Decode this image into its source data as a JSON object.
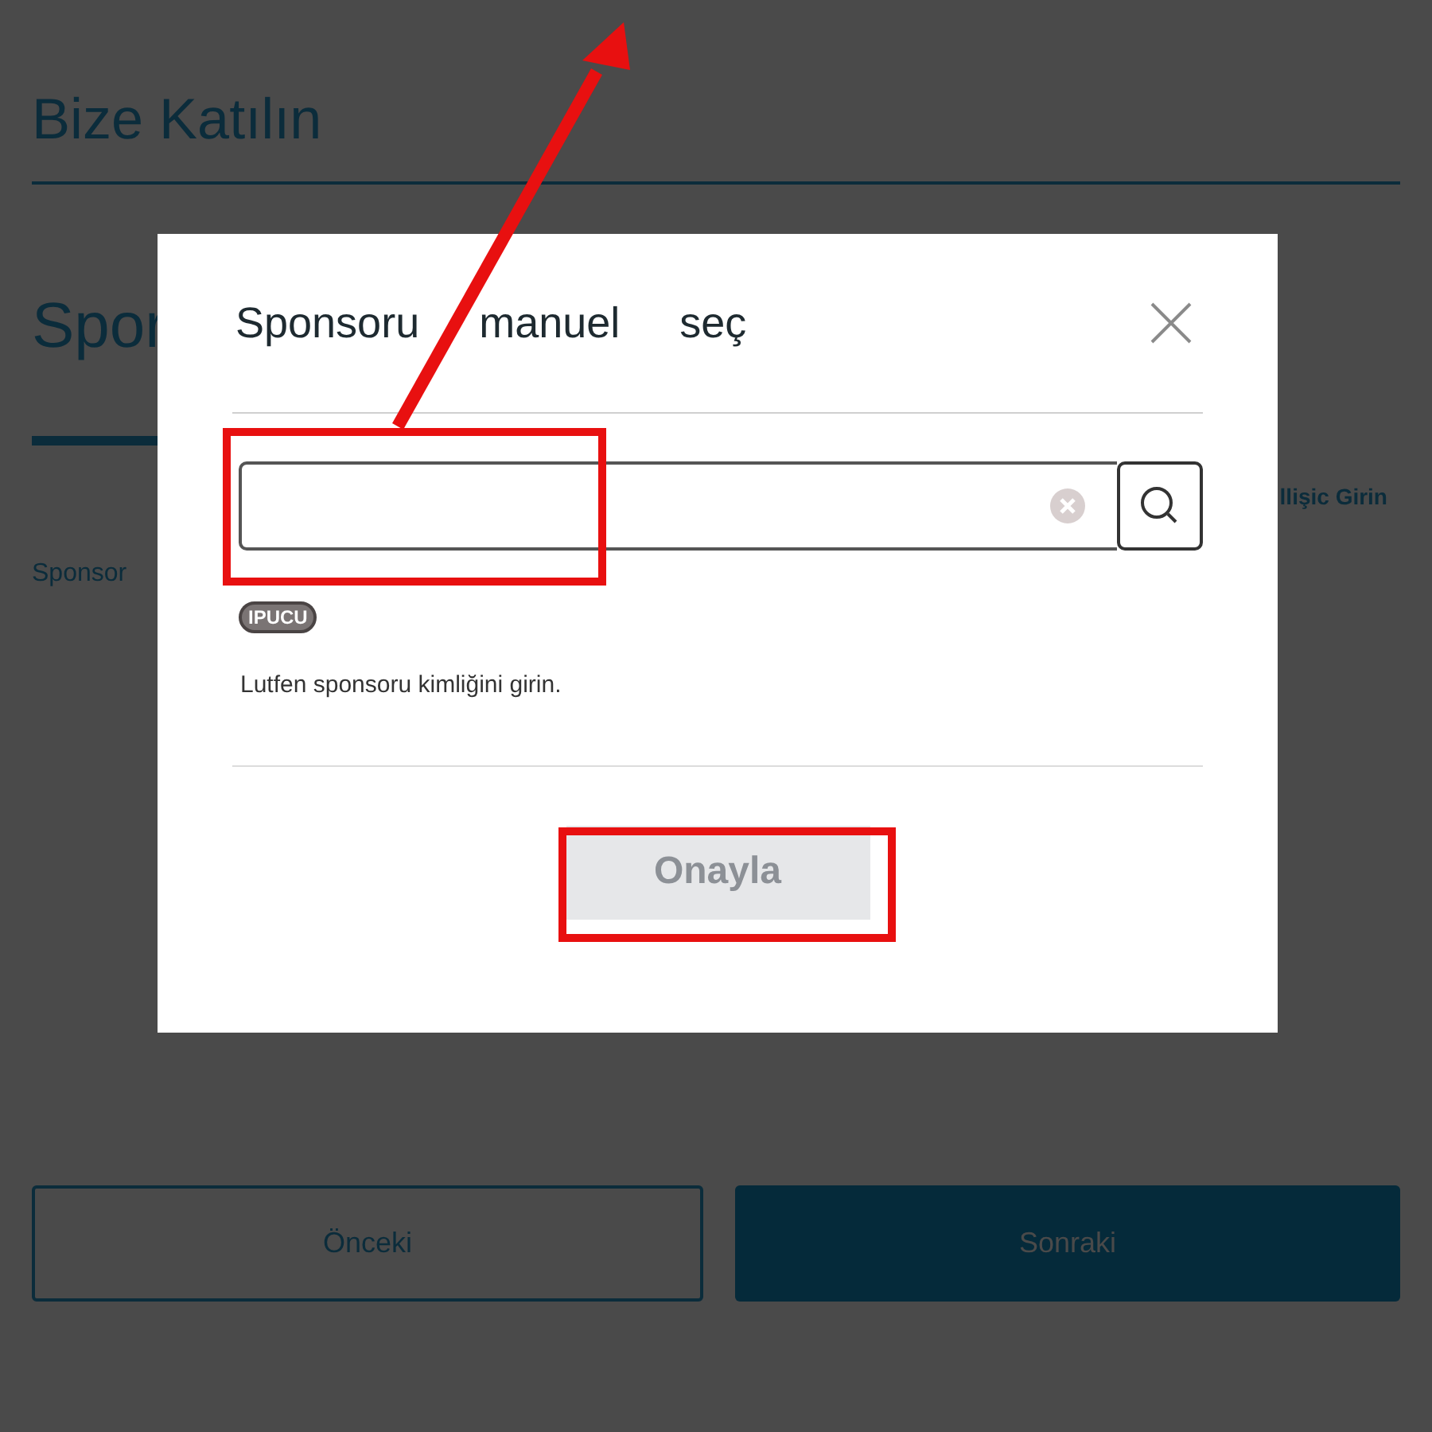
{
  "page": {
    "title": "Bize Katılın",
    "section_heading": "Spor",
    "field_label": "Sponsor",
    "side_link": "llişic Girin"
  },
  "navigation": [
    {
      "label": "Önceki",
      "kind": "outline"
    },
    {
      "label": "Sonraki",
      "kind": "filled"
    }
  ],
  "dialog": {
    "title": "Sponsoru manuel seç",
    "hint_badge": "IPUCU",
    "hint_text": "Lutfen sponsoru kimliğini girin.",
    "confirm_button": {
      "label": "Onayla",
      "disabled": true
    }
  }
}
